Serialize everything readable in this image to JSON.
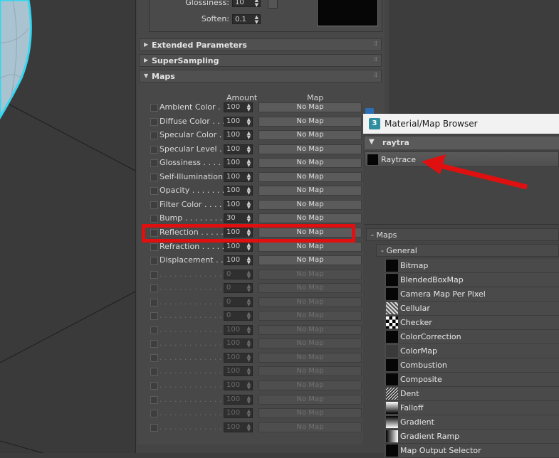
{
  "top_params": {
    "glossiness_label": "Glossiness:",
    "glossiness_value": "10",
    "soften_label": "Soften:",
    "soften_value": "0.1"
  },
  "rollouts": {
    "extended": "Extended Parameters",
    "supersampling": "SuperSampling",
    "maps": "Maps"
  },
  "maps_table": {
    "amount_header": "Amount",
    "map_header": "Map",
    "rows": [
      {
        "label": "Ambient Color . . .",
        "amount": "100",
        "map": "No Map",
        "active": true
      },
      {
        "label": "Diffuse Color . . . .",
        "amount": "100",
        "map": "No Map",
        "active": true
      },
      {
        "label": "Specular Color  . .",
        "amount": "100",
        "map": "No Map",
        "active": true
      },
      {
        "label": "Specular Level  . .",
        "amount": "100",
        "map": "No Map",
        "active": true
      },
      {
        "label": "Glossiness . . . . . .",
        "amount": "100",
        "map": "No Map",
        "active": true
      },
      {
        "label": "Self-Illumination . .",
        "amount": "100",
        "map": "No Map",
        "active": true
      },
      {
        "label": "Opacity . . . . . . . .",
        "amount": "100",
        "map": "No Map",
        "active": true
      },
      {
        "label": "Filter Color  . . . . .",
        "amount": "100",
        "map": "No Map",
        "active": true
      },
      {
        "label": "Bump . . . . . . . . .",
        "amount": "30",
        "map": "No Map",
        "active": true
      },
      {
        "label": "Reflection  . . . . .",
        "amount": "100",
        "map": "No Map",
        "active": true
      },
      {
        "label": "Refraction  . . . . .",
        "amount": "100",
        "map": "No Map",
        "active": true
      },
      {
        "label": "Displacement  . . .",
        "amount": "100",
        "map": "No Map",
        "active": true
      },
      {
        "label": ". . . . . . . . . . . . . .",
        "amount": "0",
        "map": "No Map",
        "active": false
      },
      {
        "label": ". . . . . . . . . . . . . .",
        "amount": "0",
        "map": "No Map",
        "active": false
      },
      {
        "label": ". . . . . . . . . . . . . .",
        "amount": "0",
        "map": "No Map",
        "active": false
      },
      {
        "label": ". . . . . . . . . . . . . .",
        "amount": "0",
        "map": "No Map",
        "active": false
      },
      {
        "label": ". . . . . . . . . . . . . .",
        "amount": "100",
        "map": "No Map",
        "active": false
      },
      {
        "label": ". . . . . . . . . . . . . .",
        "amount": "100",
        "map": "No Map",
        "active": false
      },
      {
        "label": ". . . . . . . . . . . . . .",
        "amount": "100",
        "map": "No Map",
        "active": false
      },
      {
        "label": ". . . . . . . . . . . . . .",
        "amount": "100",
        "map": "No Map",
        "active": false
      },
      {
        "label": ". . . . . . . . . . . . . .",
        "amount": "100",
        "map": "No Map",
        "active": false
      },
      {
        "label": ". . . . . . . . . . . . . .",
        "amount": "100",
        "map": "No Map",
        "active": false
      },
      {
        "label": ". . . . . . . . . . . . . .",
        "amount": "100",
        "map": "No Map",
        "active": false
      },
      {
        "label": ". . . . . . . . . . . . . .",
        "amount": "100",
        "map": "No Map",
        "active": false
      }
    ]
  },
  "browser": {
    "title": "Material/Map Browser",
    "logo_text": "3",
    "search_text": "raytra",
    "result": "Raytrace",
    "maps_group": "- Maps",
    "general_group": "- General",
    "items": [
      {
        "name": "Bitmap",
        "icon": "black"
      },
      {
        "name": "BlendedBoxMap",
        "icon": "black"
      },
      {
        "name": "Camera Map Per Pixel",
        "icon": "black"
      },
      {
        "name": "Cellular",
        "icon": "cellular"
      },
      {
        "name": "Checker",
        "icon": "checker"
      },
      {
        "name": "ColorCorrection",
        "icon": "black"
      },
      {
        "name": "ColorMap",
        "icon": "colormap"
      },
      {
        "name": "Combustion",
        "icon": "black"
      },
      {
        "name": "Composite",
        "icon": "black"
      },
      {
        "name": "Dent",
        "icon": "dent"
      },
      {
        "name": "Falloff",
        "icon": "falloff"
      },
      {
        "name": "Gradient",
        "icon": "gradient"
      },
      {
        "name": "Gradient Ramp",
        "icon": "ramp"
      },
      {
        "name": "Map Output Selector",
        "icon": "black"
      }
    ]
  },
  "colors": {
    "highlight": "#e11010",
    "viewport_wire": "#35d6f0"
  }
}
